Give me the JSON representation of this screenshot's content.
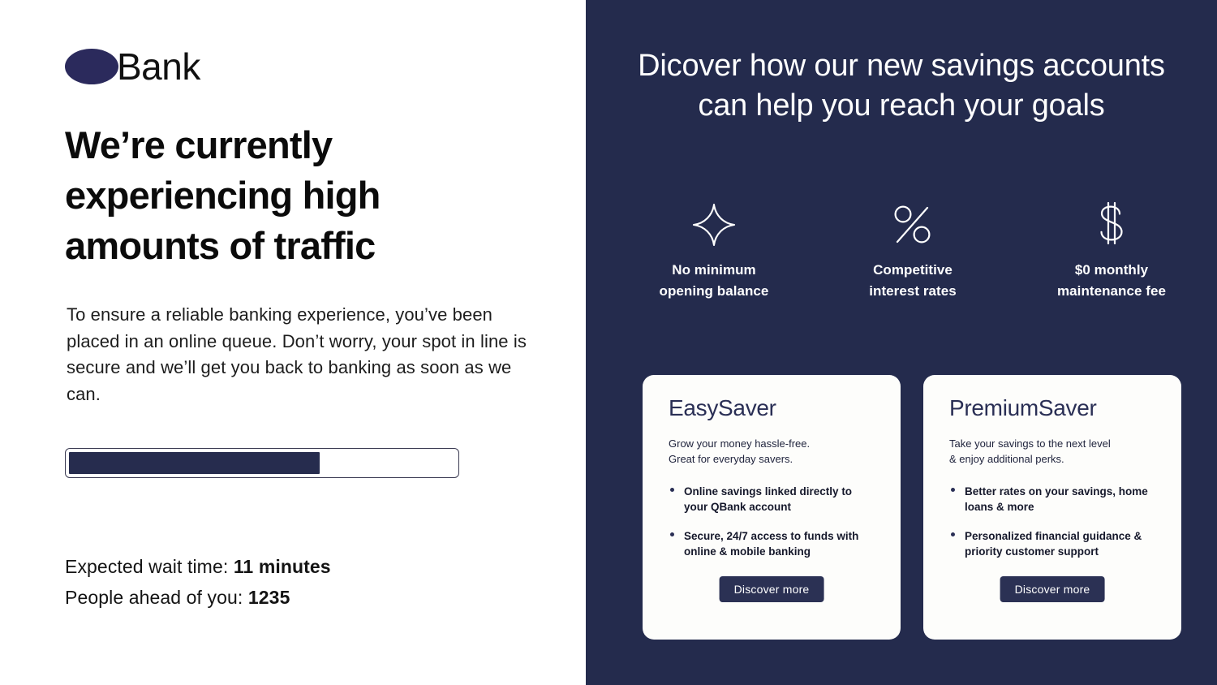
{
  "brand": {
    "mark_icon": "qbank-ellipse-logo",
    "word": "Bank",
    "full_name": "QBank"
  },
  "colors": {
    "navy": "#242b4d",
    "navy_deep": "#262c4e",
    "brand_mark": "#2b2a5c",
    "card_bg": "#fdfdfb",
    "text_dark": "#0b0b0b",
    "white": "#ffffff"
  },
  "left": {
    "headline": "We’re currently experiencing high amounts of traffic",
    "body": "To ensure a reliable banking experience, you’ve been placed in an online queue. Don’t worry, your spot in line is secure and we’ll get you back to banking as soon as we can.",
    "progress": {
      "percent": 65,
      "fill_width": "65%"
    },
    "stats": [
      {
        "label": "Expected wait time: ",
        "value": "11 minutes"
      },
      {
        "label": "People ahead of you: ",
        "value": "1235"
      }
    ]
  },
  "right": {
    "heading": "Dicover how our new savings accounts can help you reach your goals",
    "features": [
      {
        "icon": "sparkle-star-icon",
        "label": "No minimum\nopening balance"
      },
      {
        "icon": "percent-icon",
        "label": "Competitive\ninterest rates"
      },
      {
        "icon": "dollar-sign-icon",
        "label": "$0 monthly\nmaintenance fee"
      }
    ],
    "cards": [
      {
        "title": "EasySaver",
        "subtitle": "Grow your money hassle-free.\nGreat for everyday savers.",
        "bullets": [
          "Online savings linked directly to your QBank account",
          "Secure, 24/7 access to funds with online & mobile banking"
        ],
        "cta": "Discover more"
      },
      {
        "title": "PremiumSaver",
        "subtitle": "Take your savings to the next level\n& enjoy additional perks.",
        "bullets": [
          "Better rates on your savings, home loans  & more",
          "Personalized financial guidance & priority customer support"
        ],
        "cta": "Discover more"
      }
    ]
  }
}
